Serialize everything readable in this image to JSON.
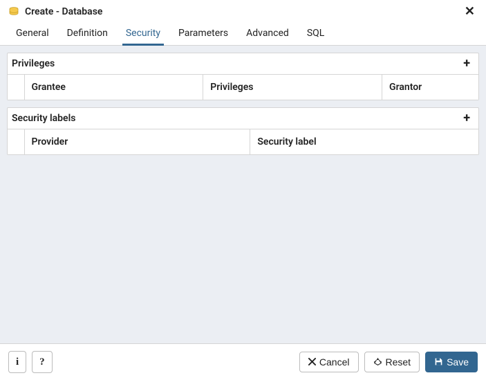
{
  "titlebar": {
    "title": "Create - Database"
  },
  "tabs": [
    {
      "id": "general",
      "label": "General"
    },
    {
      "id": "definition",
      "label": "Definition"
    },
    {
      "id": "security",
      "label": "Security"
    },
    {
      "id": "parameters",
      "label": "Parameters"
    },
    {
      "id": "advanced",
      "label": "Advanced"
    },
    {
      "id": "sql",
      "label": "SQL"
    }
  ],
  "active_tab": "security",
  "sections": {
    "privileges": {
      "title": "Privileges",
      "columns": {
        "grantee": "Grantee",
        "privileges": "Privileges",
        "grantor": "Grantor"
      }
    },
    "security_labels": {
      "title": "Security labels",
      "columns": {
        "provider": "Provider",
        "security_label": "Security label"
      }
    }
  },
  "footer": {
    "info": "i",
    "help": "?",
    "cancel": "Cancel",
    "reset": "Reset",
    "save": "Save"
  }
}
